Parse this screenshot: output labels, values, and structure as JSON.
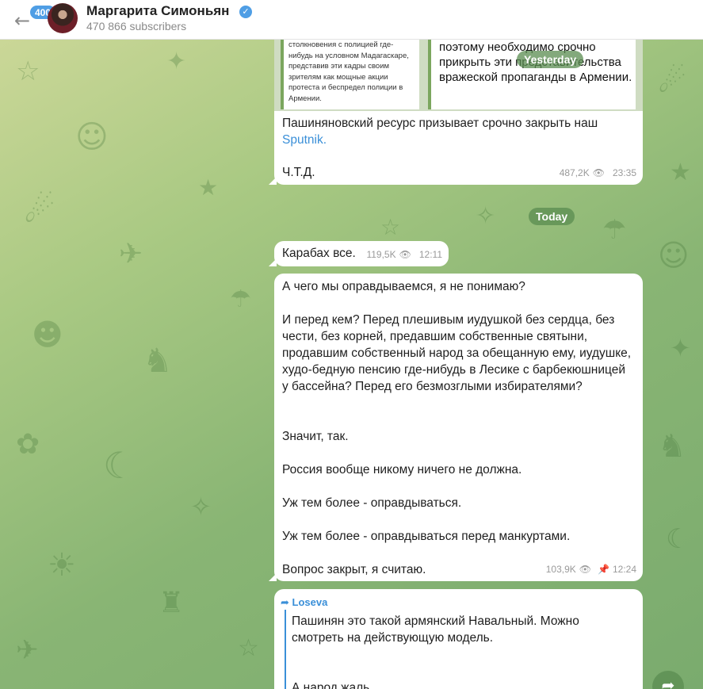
{
  "header": {
    "back_icon": "arrow-left-icon",
    "unread_count": "400",
    "channel_title": "Маргарита Симоньян",
    "verified_icon": "check-badge-icon",
    "subscribers": "470 866 subscribers"
  },
  "days": {
    "yesterday": "Yesterday",
    "today": "Today"
  },
  "messages": [
    {
      "media_left_text": "столкновения с полицией где-нибудь на условном Мадагаскаре, представив эти кадры своим зрителям как мощные акции протеста и беспредел полиции в Армении.",
      "media_right_text": "поэтому необходимо срочно прикрыть эти представительства вражеской пропаганды в Армении.",
      "text_before_link": "Пашиняновский ресурс призывает срочно закрыть наш ",
      "link": "Sputnik",
      "text_after_link": ".",
      "text2": "Ч.Т.Д.",
      "views": "487,2K",
      "time": "23:35"
    },
    {
      "text": "Карабах все.",
      "views": "119,5K",
      "time": "12:11"
    },
    {
      "paragraphs": [
        "А чего мы оправдываемся, я не понимаю?",
        "И перед кем? Перед плешивым иудушкой без сердца, без чести, без корней, предавшим собственные святыни, продавшим собственный народ за обещанную ему, иудушке, худо-бедную пенсию где-нибудь в Лесике с барбекюшницей у бассейна? Перед его безмозглыми избирателями?",
        "Значит, так.",
        "Россия вообще никому ничего не должна.",
        "Уж тем более - оправдываться.",
        "Уж тем более - оправдываться перед манкуртами.",
        "Вопрос закрыт, я считаю."
      ],
      "views": "103,9K",
      "time": "12:24",
      "pinned_icon": "pin-icon"
    },
    {
      "forwarded_from": "Loseva",
      "paragraphs": [
        "Пашинян это такой армянский Навальный. Можно смотреть на действующую модель.",
        "А народ жаль."
      ]
    }
  ],
  "scroll_button_icon": "share-arrow-icon"
}
